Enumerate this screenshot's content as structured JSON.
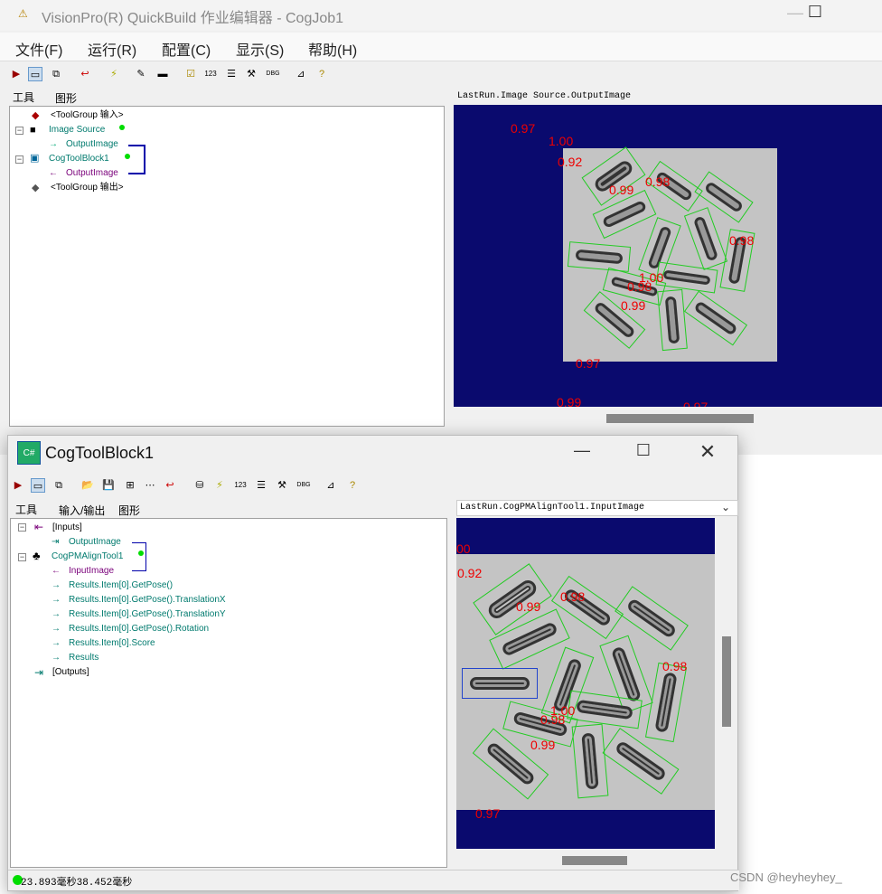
{
  "win1": {
    "title": "VisionPro(R) QuickBuild 作业编辑器 - CogJob1",
    "menu": [
      "文件(F)",
      "运行(R)",
      "配置(C)",
      "显示(S)",
      "帮助(H)"
    ],
    "tabs": [
      "工具",
      "图形"
    ],
    "tree": [
      {
        "label": "<ToolGroup 输入>",
        "color": "blk"
      },
      {
        "label": "Image Source",
        "color": "green"
      },
      {
        "label": "OutputImage",
        "color": "green"
      },
      {
        "label": "CogToolBlock1",
        "color": "green"
      },
      {
        "label": "OutputImage",
        "color": "purple"
      },
      {
        "label": "<ToolGroup 输出>",
        "color": "blk"
      }
    ],
    "image_label": "LastRun.Image Source.OutputImage",
    "scores": [
      "0.97",
      "1.00",
      "0.92",
      "0.99",
      "0.98",
      "0.98",
      "1.00",
      "0.98",
      "0.99",
      "0.97",
      "0.99",
      "0.97"
    ]
  },
  "win2": {
    "title": "CogToolBlock1",
    "tabs": [
      "工具",
      "输入/输出",
      "图形"
    ],
    "tree": [
      {
        "label": "[Inputs]",
        "color": "blk"
      },
      {
        "label": "OutputImage",
        "color": "green"
      },
      {
        "label": "CogPMAlignTool1",
        "color": "green"
      },
      {
        "label": "InputImage",
        "color": "purple"
      },
      {
        "label": "Results.Item[0].GetPose()",
        "color": "green"
      },
      {
        "label": "Results.Item[0].GetPose().TranslationX",
        "color": "green"
      },
      {
        "label": "Results.Item[0].GetPose().TranslationY",
        "color": "green"
      },
      {
        "label": "Results.Item[0].GetPose().Rotation",
        "color": "green"
      },
      {
        "label": "Results.Item[0].Score",
        "color": "green"
      },
      {
        "label": "Results",
        "color": "green"
      },
      {
        "label": "[Outputs]",
        "color": "blk"
      }
    ],
    "image_label": "LastRun.CogPMAlignTool1.InputImage",
    "scores": [
      "00",
      "0.92",
      "0.99",
      "0.98",
      "0.98",
      "1.00",
      "0.98",
      "0.99",
      "0.97"
    ],
    "status": "23.893毫秒38.452毫秒"
  },
  "credit": "CSDN @heyheyhey_"
}
